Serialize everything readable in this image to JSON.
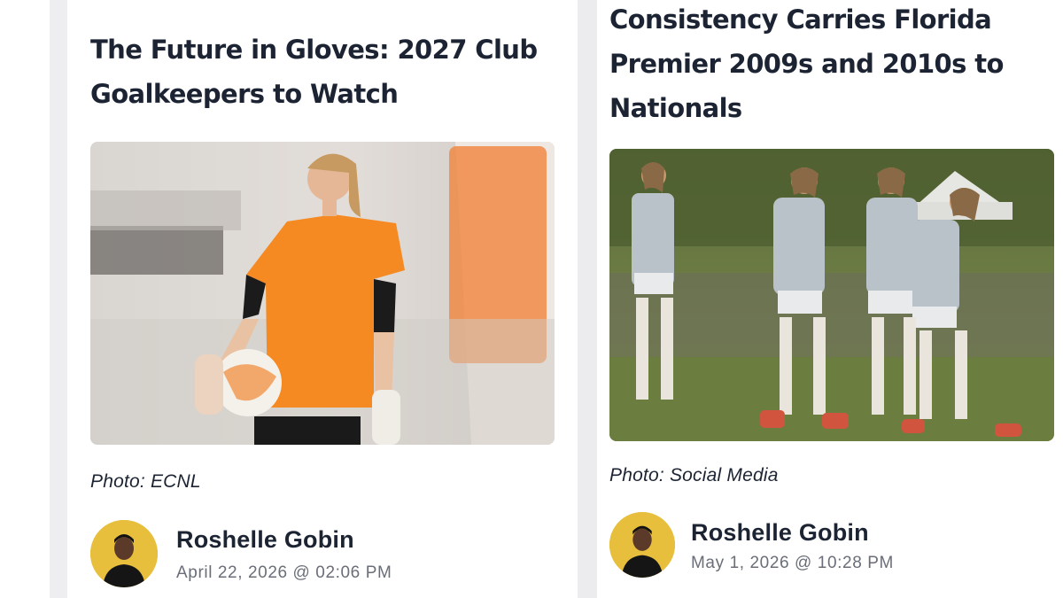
{
  "articles": [
    {
      "title": "The Future in Gloves: 2027 Club Goalkeepers to Watch",
      "photo_caption": "Photo: ECNL",
      "author": "Roshelle Gobin",
      "date": "April 22, 2026 @ 02:06 PM"
    },
    {
      "title": "Consistency Carries Florida Premier 2009s and 2010s to Nationals",
      "photo_caption": "Photo: Social Media",
      "author": "Roshelle Gobin",
      "date": "May 1, 2026 @ 10:28 PM"
    }
  ],
  "colors": {
    "title_text": "#1c2433",
    "meta_text": "#6a6e78",
    "avatar_bg": "#e7bf3c",
    "goalkeeper_jersey": "#f58a23"
  }
}
